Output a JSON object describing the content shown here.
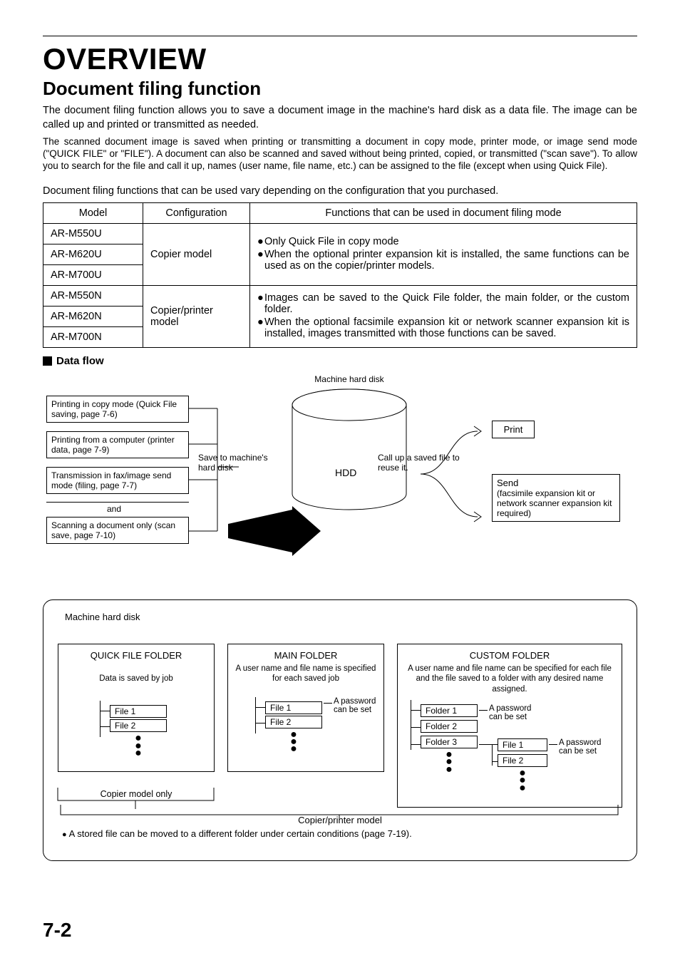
{
  "page": {
    "title": "OVERVIEW",
    "subtitle": "Document filing function",
    "p1": "The document filing function allows you to save a document image in the machine's hard disk as a data file. The image can be called up and printed or transmitted as needed.",
    "p2": "The scanned document image is saved when printing or transmitting a document in copy mode, printer mode, or image send mode (\"QUICK FILE\" or \"FILE\"). A document can also be scanned and saved without being printed, copied, or transmitted (\"scan save\"). To allow you to search for the file and call it up, names (user name, file name, etc.) can be assigned to the file (except when using Quick File).",
    "p3": "Document filing functions that can be used vary depending on the configuration that you purchased.",
    "table": {
      "h1": "Model",
      "h2": "Configuration",
      "h3": "Functions that can be used in document filing mode",
      "models_copier": [
        "AR-M550U",
        "AR-M620U",
        "AR-M700U"
      ],
      "models_printer": [
        "AR-M550N",
        "AR-M620N",
        "AR-M700N"
      ],
      "config_copier": "Copier model",
      "config_printer": "Copier/printer model",
      "func_copier_b1": "Only Quick File in copy mode",
      "func_copier_b2": "When the optional printer expansion kit is installed, the same functions can be used as on the copier/printer models.",
      "func_printer_b1": "Images can be saved to the Quick File folder, the main folder, or the custom folder.",
      "func_printer_b2": "When the optional facsimile expansion kit or network scanner expansion kit is installed, images transmitted with those functions can be saved."
    },
    "dataflow_label": "Data flow",
    "flow": {
      "b1": "Printing in copy mode (Quick File saving, page 7-6)",
      "b2": "Printing from a computer (printer data, page 7-9)",
      "b3": "Transmission in fax/image send mode (filing, page 7-7)",
      "and": "and",
      "b4": "Scanning a document only (scan save, page 7-10)",
      "save_label": "Save to machine's hard disk",
      "disk_label": "Machine hard disk",
      "hdd": "HDD",
      "call_label": "Call up a saved file to reuse it.",
      "print": "Print",
      "send_t": "Send",
      "send_d": "(facsimile expansion kit or network scanner expansion kit required)"
    },
    "detail": {
      "title": "Machine hard disk",
      "quick_title": "QUICK FILE FOLDER",
      "quick_desc": "Data is saved by job",
      "main_title": "MAIN FOLDER",
      "main_desc": "A user name and file name is specified for each saved job",
      "custom_title": "CUSTOM FOLDER",
      "custom_desc": "A user name and file name can be specified for each file and the file saved to a folder with any desired name assigned.",
      "file1": "File 1",
      "file2": "File 2",
      "folder1": "Folder 1",
      "folder2": "Folder 2",
      "folder3": "Folder 3",
      "pw": "A password can be set",
      "copier_only": "Copier model only",
      "footer_center": "Copier/printer model",
      "footer_bullet": "A stored file can be moved to a different folder under certain conditions (page 7-19)."
    },
    "page_number": "7-2"
  }
}
